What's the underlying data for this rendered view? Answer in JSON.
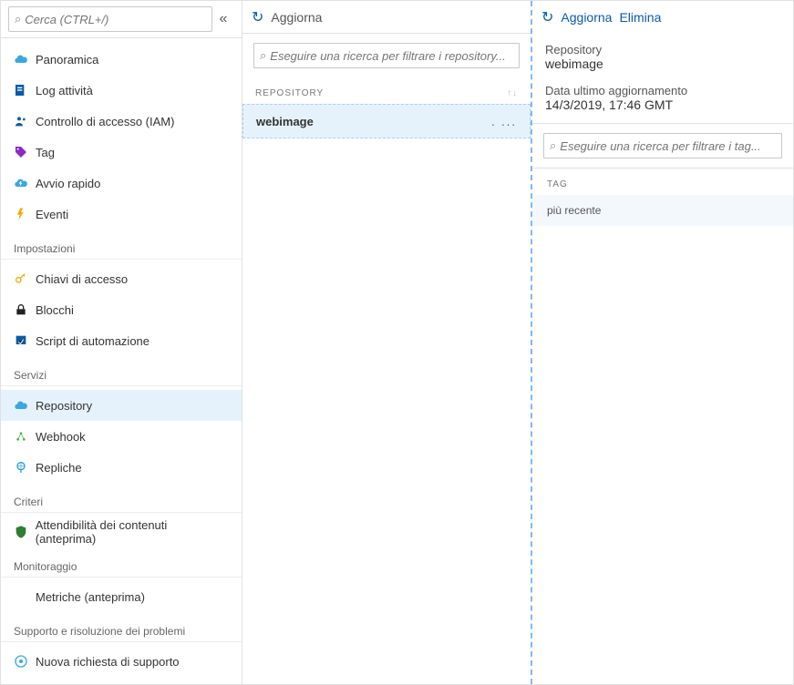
{
  "sidebar": {
    "search_placeholder": "Cerca (CTRL+/)",
    "main_items": [
      {
        "label": "Panoramica",
        "icon": "cloud",
        "color": "#3ba7e0"
      },
      {
        "label": "Log attività",
        "icon": "log",
        "color": "#0b5aa7"
      },
      {
        "label": "Controllo di accesso (IAM)",
        "icon": "iam",
        "color": "#0b5aa7"
      },
      {
        "label": "Tag",
        "icon": "tag",
        "color": "#8a2ac7"
      },
      {
        "label": "Avvio rapido",
        "icon": "quick",
        "color": "#3ba7e0"
      },
      {
        "label": "Eventi",
        "icon": "bolt",
        "color": "#f2a900"
      }
    ],
    "sections": [
      {
        "title": "Impostazioni",
        "items": [
          {
            "label": "Chiavi di accesso",
            "icon": "key",
            "color": "#f2a900"
          },
          {
            "label": "Blocchi",
            "icon": "lock",
            "color": "#222"
          },
          {
            "label": "Script di automazione",
            "icon": "script",
            "color": "#0b5aa7"
          }
        ]
      },
      {
        "title": "Servizi",
        "items": [
          {
            "label": "Repository",
            "icon": "cloud",
            "color": "#3ba7e0",
            "active": true
          },
          {
            "label": "Webhook",
            "icon": "webhook",
            "color": "#4caf50"
          },
          {
            "label": "Repliche",
            "icon": "globe",
            "color": "#22a0d6"
          }
        ]
      },
      {
        "title": "Criteri",
        "items": [
          {
            "label": "Attendibilità dei contenuti (anteprima)",
            "icon": "shield",
            "color": "#2e7d32"
          }
        ]
      },
      {
        "title": "Monitoraggio",
        "items": [
          {
            "label": "Metriche (anteprima)",
            "icon": "",
            "color": ""
          }
        ]
      },
      {
        "title": "Supporto e  risoluzione dei problemi",
        "items": [
          {
            "label": "Nuova richiesta di supporto",
            "icon": "support",
            "color": "#3ba7e0"
          }
        ]
      }
    ]
  },
  "col2": {
    "refresh_label": "Aggiorna",
    "filter_placeholder": "Eseguire una ricerca per filtrare i repository...",
    "col_header": "REPOSITORY",
    "rows": [
      {
        "name": "webimage"
      }
    ]
  },
  "col3": {
    "refresh_label": "Aggiorna",
    "delete_label": "Elimina",
    "repo_label": "Repository",
    "repo_name": "webimage",
    "updated_label": "Data ultimo aggiornamento",
    "updated_value": "14/3/2019, 17:46 GMT",
    "filter_placeholder": "Eseguire una ricerca per filtrare i tag...",
    "tag_col_header": "TAG",
    "tags": [
      {
        "name": "più recente"
      }
    ]
  }
}
